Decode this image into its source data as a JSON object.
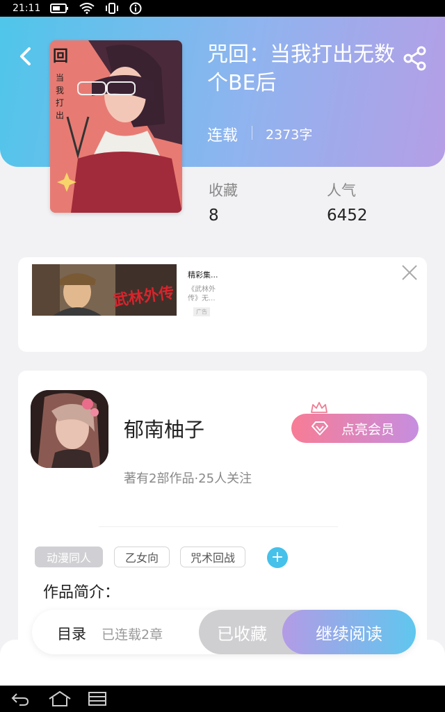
{
  "status_bar": {
    "time": "21:11",
    "icons": [
      "battery-icon",
      "wifi-icon",
      "vibrate-icon",
      "info-icon"
    ]
  },
  "book": {
    "title": "咒回：当我打出无数个BE后",
    "status": "连载",
    "word_count": "2373字",
    "stats": [
      {
        "label": "收藏",
        "value": "8"
      },
      {
        "label": "人气",
        "value": "6452"
      }
    ]
  },
  "ad": {
    "title": "精彩集...",
    "description": "《武林外传》无...",
    "badge": "广告",
    "image_caption": "武林外传"
  },
  "author": {
    "name": "郁南柚子",
    "meta": "著有2部作品·25人关注",
    "vip_button": "点亮会员"
  },
  "tags": [
    "动漫同人",
    "乙女向",
    "咒术回战"
  ],
  "intro_label": "作品简介：",
  "bottom_bar": {
    "toc_label": "目录",
    "toc_status": "已连载2章",
    "collected_label": "已收藏",
    "read_label": "继续阅读"
  },
  "colors": {
    "header_start": "#4fc6ea",
    "header_end": "#b59ee6",
    "accent_blue": "#45c1ea"
  }
}
